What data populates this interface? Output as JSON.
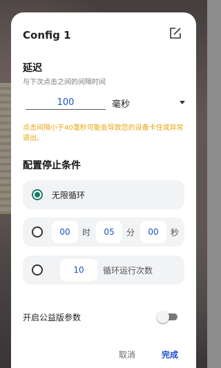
{
  "dialog": {
    "title": "Config 1",
    "delay_section": {
      "heading": "延迟",
      "hint": "与下次点击之间的间隔时间",
      "value": "100",
      "unit": "毫秒",
      "warning": "点击间隔小于40毫秒可能会导致您的设备卡住或异常退出。"
    },
    "stop_section": {
      "heading": "配置停止条件",
      "options": [
        {
          "label": "无限循环",
          "selected": true
        },
        {
          "hours": "00",
          "hours_unit": "时",
          "minutes": "05",
          "minutes_unit": "分",
          "seconds": "00",
          "seconds_unit": "秒",
          "selected": false
        },
        {
          "count": "10",
          "label": "循环运行次数",
          "selected": false
        }
      ]
    },
    "public_params": {
      "label": "开启公益版参数",
      "enabled": false
    },
    "buttons": {
      "cancel": "取消",
      "done": "完成"
    }
  },
  "colors": {
    "accent": "#1a50c8",
    "warning": "#e8a40f",
    "radio": "#1a7a6a"
  },
  "icons": {
    "edit": "edit-icon",
    "dropdown": "dropdown-icon"
  }
}
